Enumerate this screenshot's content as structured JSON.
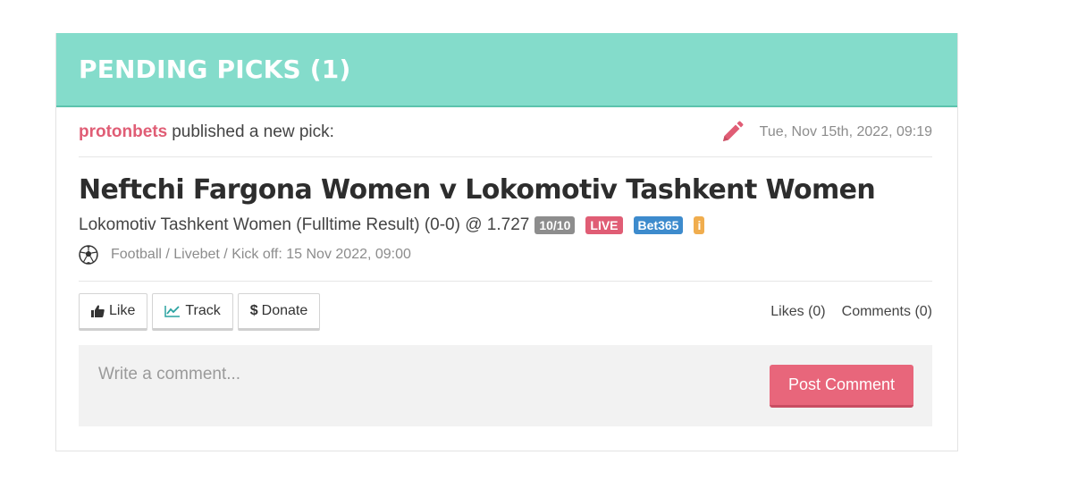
{
  "panel": {
    "title": "PENDING PICKS (1)"
  },
  "pick": {
    "author": "protonbets",
    "published_text": "published a new pick:",
    "date": "Tue, Nov 15th, 2022, 09:19",
    "event": "Neftchi Fargona Women v Lokomotiv Tashkent Women",
    "selection": "Lokomotiv Tashkent Women (Fulltime Result) (0-0) @ 1.727",
    "badges": {
      "stake": "10/10",
      "live": "LIVE",
      "bookmaker": "Bet365",
      "info": "i"
    },
    "sport_line": "Football / Livebet / Kick off: 15 Nov 2022, 09:00",
    "icons": {
      "edit": "pencil-icon",
      "sport": "soccer-ball-icon"
    }
  },
  "actions": {
    "like": "Like",
    "track": "Track",
    "donate": "Donate",
    "likes_count": "Likes (0)",
    "comments_count": "Comments (0)"
  },
  "comment": {
    "placeholder": "Write a comment...",
    "post_label": "Post Comment"
  },
  "colors": {
    "header_bg": "#84dccb",
    "author": "#e05d75",
    "live_badge": "#e05d75",
    "bet_badge": "#3d8bcd",
    "info_badge": "#f0ad4e",
    "stake_badge": "#8d8d8d",
    "post_button": "#e8667b"
  }
}
